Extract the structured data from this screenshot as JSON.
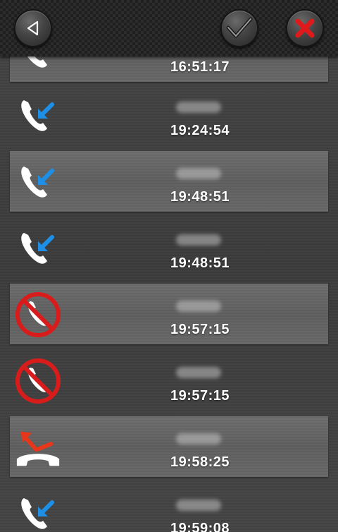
{
  "toolbar": {
    "back_icon": "back-triangle-icon",
    "confirm_icon": "checkmark-icon",
    "close_icon": "close-x-icon",
    "close_color": "#e01a1a"
  },
  "calls": [
    {
      "type": "incoming",
      "icon": "incoming-call-icon",
      "time": "16:51:17"
    },
    {
      "type": "incoming",
      "icon": "incoming-call-icon",
      "time": "19:24:54"
    },
    {
      "type": "incoming",
      "icon": "incoming-call-icon",
      "time": "19:48:51"
    },
    {
      "type": "incoming",
      "icon": "incoming-call-icon",
      "time": "19:48:51"
    },
    {
      "type": "blocked",
      "icon": "blocked-call-icon",
      "time": "19:57:15"
    },
    {
      "type": "blocked",
      "icon": "blocked-call-icon",
      "time": "19:57:15"
    },
    {
      "type": "outgoing",
      "icon": "outgoing-call-icon",
      "time": "19:58:25"
    },
    {
      "type": "incoming",
      "icon": "incoming-call-icon",
      "time": "19:59:08"
    }
  ],
  "colors": {
    "incoming_arrow": "#1e8fe6",
    "blocked": "#d81c1c",
    "outgoing_arrow": "#e8361a",
    "time_text": "#ffffff"
  }
}
